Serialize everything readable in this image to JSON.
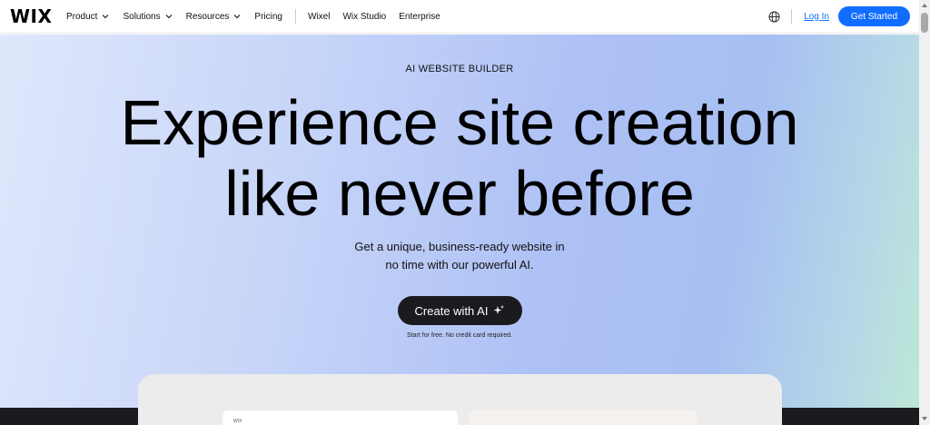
{
  "brand": {
    "logo": "WIX"
  },
  "nav": {
    "items": [
      {
        "label": "Product",
        "dropdown": true
      },
      {
        "label": "Solutions",
        "dropdown": true
      },
      {
        "label": "Resources",
        "dropdown": true
      },
      {
        "label": "Pricing",
        "dropdown": false
      }
    ],
    "secondary": [
      "Wixel",
      "Wix Studio",
      "Enterprise"
    ],
    "login": "Log In",
    "cta": "Get Started"
  },
  "hero": {
    "eyebrow": "AI WEBSITE BUILDER",
    "headline_line1": "Experience site creation",
    "headline_line2": "like never before",
    "sub_line1": "Get a unique, business-ready website in",
    "sub_line2": "no time with our powerful AI.",
    "cta": "Create with AI",
    "note": "Start for free. No credit card required."
  },
  "preview": {
    "card_text": "WIX"
  },
  "colors": {
    "accent": "#116dff",
    "dark": "#1b1b1f"
  }
}
